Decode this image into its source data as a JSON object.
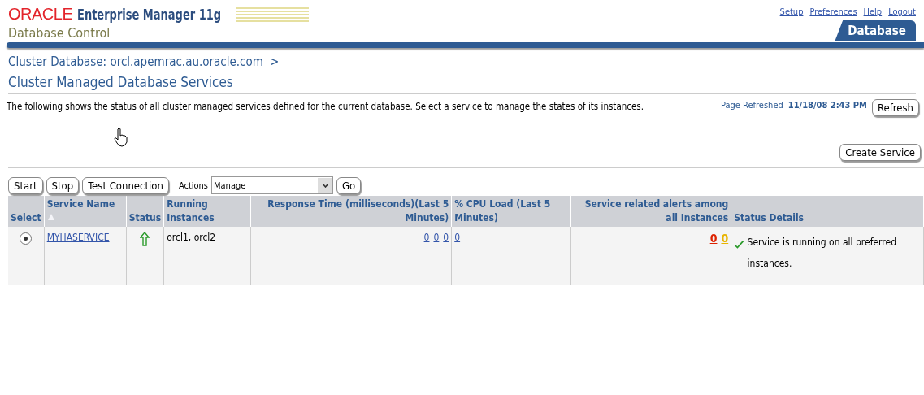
{
  "header": {
    "brand": "ORACLE",
    "product": "Enterprise Manager 11g",
    "subtitle": "Database Control",
    "links": [
      "Setup",
      "Preferences",
      "Help",
      "Logout"
    ],
    "tab": {
      "label": "Database",
      "selected": true
    }
  },
  "breadcrumb": "Cluster Database: orcl.apemrac.au.oracle.com",
  "breadcrumb_separator": ">",
  "page_title": "Cluster Managed Database Services",
  "description": "The following shows the status of all cluster managed services defined for the current database. Select a service to manage the states of its instances.",
  "refreshed_label": "Page Refreshed",
  "refreshed_time": "11/18/08 2:43 PM",
  "refresh_button": "Refresh",
  "create_button": "Create Service",
  "toolbar": {
    "buttons": [
      "Start",
      "Stop",
      "Test Connection"
    ],
    "actions_label": "Actions",
    "actions_value": "Manage",
    "go": "Go"
  },
  "table": {
    "columns": [
      {
        "label": "Select",
        "sorted": false
      },
      {
        "label": "Service Name",
        "sorted": true
      },
      {
        "label": "Status",
        "sorted": false
      },
      {
        "label": "Running Instances",
        "sorted": false
      },
      {
        "label": "Response Time (milliseconds)(Last 5 Minutes)",
        "sorted": false
      },
      {
        "label": "% CPU Load (Last 5 Minutes)",
        "sorted": false
      },
      {
        "label": "Service related alerts among all Instances",
        "sorted": false
      },
      {
        "label": "Status Details",
        "sorted": false
      }
    ],
    "rows": [
      {
        "selected": true,
        "name": "MYHASERVICE",
        "running": true,
        "instances": "orcl1, orcl2",
        "response": [
          "0",
          "0",
          "0"
        ],
        "cpu": [
          "0"
        ],
        "alerts": [
          {
            "text": "0",
            "color": "#dd2200"
          },
          {
            "text": "0",
            "color": "#e8b400"
          }
        ],
        "details": "Service is running on all preferred instances."
      }
    ]
  }
}
